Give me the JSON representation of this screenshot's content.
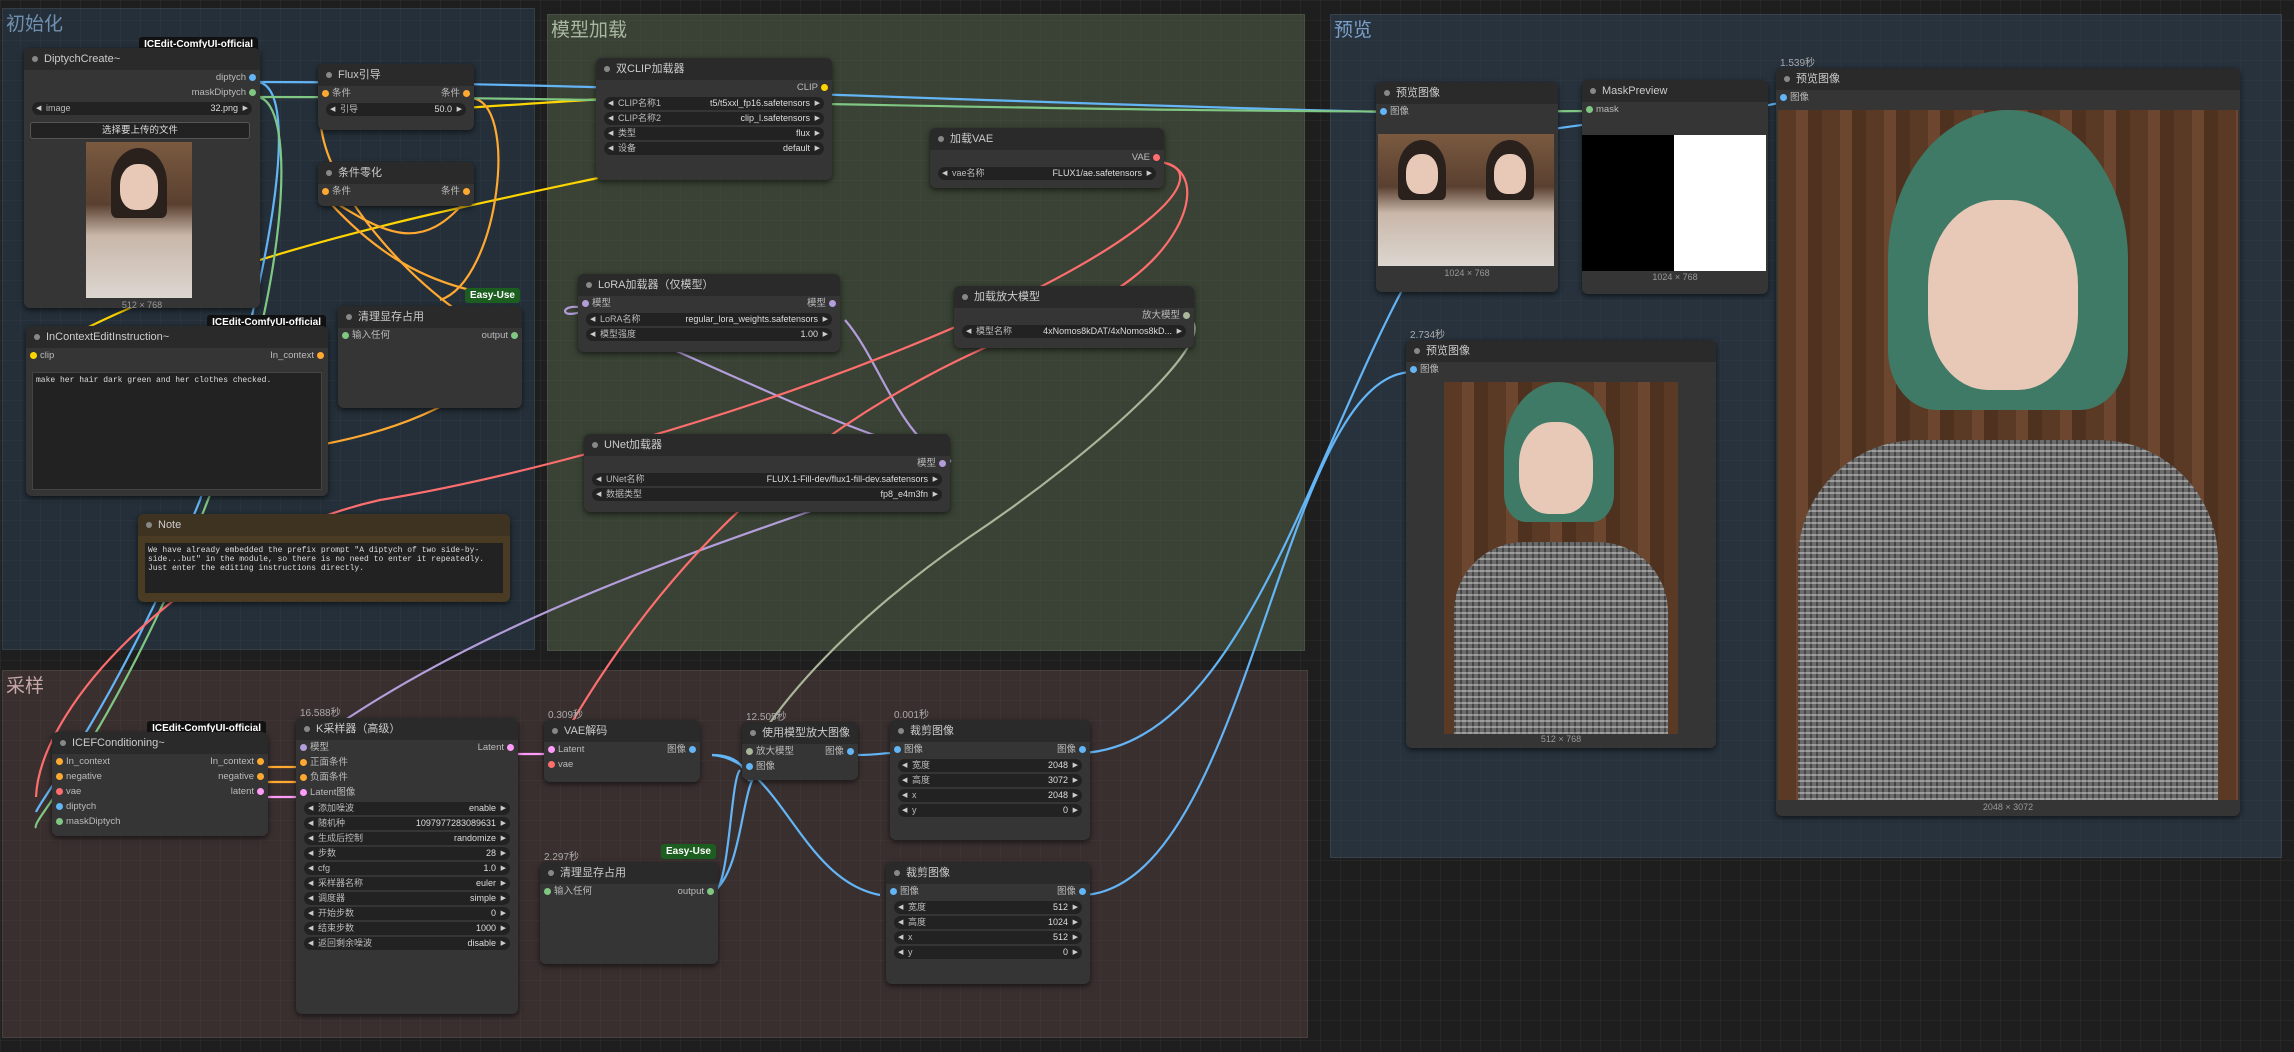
{
  "groups": {
    "init": "初始化",
    "model": "模型加载",
    "preview": "预览",
    "sample": "采样"
  },
  "colors": {
    "clip": "#ffd500",
    "model": "#b39ddb",
    "vae": "#ff6e6e",
    "image": "#64b5f6",
    "cond": "#ffa931",
    "latent": "#ff9cf9",
    "mask": "#81c784",
    "upscale": "#aab59a"
  },
  "nodes": {
    "diptych": {
      "title": "DiptychCreate~",
      "badge": "ICEdit-ComfyUI-official",
      "out1": "diptych",
      "out2": "maskDiptych",
      "w_image_label": "image",
      "w_image_value": "32.png",
      "upload": "选择要上传的文件",
      "img_caption": "512 × 768"
    },
    "flux_guide": {
      "title": "Flux引导",
      "in": "条件",
      "out": "条件",
      "w_label": "引导",
      "w_value": "50.0"
    },
    "cond_zero": {
      "title": "条件零化",
      "in": "条件",
      "out": "条件"
    },
    "incontext": {
      "title": "InContextEditInstruction~",
      "badge": "ICEdit-ComfyUI-official",
      "in": "clip",
      "out": "In_context",
      "prompt": "make her hair dark green and her clothes checked."
    },
    "clean1": {
      "title": "清理显存占用",
      "badge": "Easy-Use",
      "in": "输入任何",
      "out": "output"
    },
    "note": {
      "title": "Note",
      "text": "We have already embedded the prefix prompt \"A diptych of two side-by-side...but\" in the module, so there is no need to enter it repeatedly. Just enter the editing instructions directly."
    },
    "dualclip": {
      "title": "双CLIP加载器",
      "out": "CLIP",
      "w1l": "CLIP名称1",
      "w1v": "t5/t5xxl_fp16.safetensors",
      "w2l": "CLIP名称2",
      "w2v": "clip_l.safetensors",
      "w3l": "类型",
      "w3v": "flux",
      "w4l": "设备",
      "w4v": "default"
    },
    "vae_loader": {
      "title": "加载VAE",
      "out": "VAE",
      "wl": "vae名称",
      "wv": "FLUX1/ae.safetensors"
    },
    "lora": {
      "title": "LoRA加载器（仅模型）",
      "in": "模型",
      "out": "模型",
      "w1l": "LoRA名称",
      "w1v": "regular_lora_weights.safetensors",
      "w2l": "模型强度",
      "w2v": "1.00"
    },
    "upscale_loader": {
      "title": "加载放大模型",
      "out": "放大模型",
      "wl": "模型名称",
      "wv": "4xNomos8kDAT/4xNomos8kD..."
    },
    "unet": {
      "title": "UNet加载器",
      "out": "模型",
      "w1l": "UNet名称",
      "w1v": "FLUX.1-Fill-dev/flux1-fill-dev.safetensors",
      "w2l": "数据类型",
      "w2v": "fp8_e4m3fn"
    },
    "preview1": {
      "title": "预览图像",
      "in": "图像",
      "caption": "1024 × 768"
    },
    "maskpreview": {
      "title": "MaskPreview",
      "in": "mask",
      "caption": "1024 × 768"
    },
    "preview2": {
      "title": "预览图像",
      "in": "图像",
      "timing": "2.734秒",
      "caption": "512 × 768"
    },
    "preview3": {
      "title": "预览图像",
      "in": "图像",
      "timing": "1.539秒",
      "caption": "2048 × 3072"
    },
    "icef": {
      "title": "ICEFConditioning~",
      "badge": "ICEdit-ComfyUI-official",
      "in1": "In_context",
      "in2": "negative",
      "in3": "vae",
      "in4": "diptych",
      "in5": "maskDiptych",
      "out1": "In_context",
      "out2": "negative",
      "out3": "latent"
    },
    "ksampler": {
      "title": "K采样器（高级）",
      "timing": "16.588秒",
      "in1": "模型",
      "in2": "正面条件",
      "in3": "负面条件",
      "in4": "Latent图像",
      "out": "Latent",
      "widgets": [
        {
          "l": "添加噪波",
          "v": "enable"
        },
        {
          "l": "随机种",
          "v": "1097977283089631"
        },
        {
          "l": "生成后控制",
          "v": "randomize"
        },
        {
          "l": "步数",
          "v": "28"
        },
        {
          "l": "cfg",
          "v": "1.0"
        },
        {
          "l": "采样器名称",
          "v": "euler"
        },
        {
          "l": "调度器",
          "v": "simple"
        },
        {
          "l": "开始步数",
          "v": "0"
        },
        {
          "l": "结束步数",
          "v": "1000"
        },
        {
          "l": "返回剩余噪波",
          "v": "disable"
        }
      ]
    },
    "vae_decode": {
      "title": "VAE解码",
      "timing": "0.309秒",
      "in1": "Latent",
      "in2": "vae",
      "out": "图像"
    },
    "upscale_use": {
      "title": "使用模型放大图像",
      "timing": "12.505秒",
      "in1": "放大模型",
      "in2": "图像",
      "out": "图像"
    },
    "crop1": {
      "title": "裁剪图像",
      "timing": "0.001秒",
      "in": "图像",
      "out": "图像",
      "widgets": [
        {
          "l": "宽度",
          "v": "2048"
        },
        {
          "l": "高度",
          "v": "3072"
        },
        {
          "l": "x",
          "v": "2048"
        },
        {
          "l": "y",
          "v": "0"
        }
      ]
    },
    "clean2": {
      "title": "清理显存占用",
      "timing": "2.297秒",
      "badge": "Easy-Use",
      "in": "输入任何",
      "out": "output"
    },
    "crop2": {
      "title": "裁剪图像",
      "in": "图像",
      "out": "图像",
      "widgets": [
        {
          "l": "宽度",
          "v": "512"
        },
        {
          "l": "高度",
          "v": "1024"
        },
        {
          "l": "x",
          "v": "512"
        },
        {
          "l": "y",
          "v": "0"
        }
      ]
    }
  }
}
